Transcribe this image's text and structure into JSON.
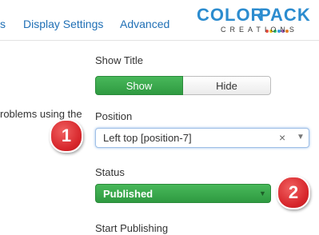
{
  "tabs": {
    "partial_left": "s",
    "display_settings": "Display Settings",
    "advanced": "Advanced"
  },
  "logo": {
    "word_color": "COLOR",
    "word_pack": "PACK",
    "subtitle": "CREATIONS",
    "colors": {
      "blue": "#2c8ccf",
      "dots": [
        "#e84c3d",
        "#f1c40f",
        "#2ecc71",
        "#3498db",
        "#9b59b6",
        "#e67e22"
      ]
    }
  },
  "side_text": "roblems using the",
  "fields": {
    "show_title": {
      "label": "Show Title",
      "options": [
        "Show",
        "Hide"
      ],
      "selected": "Show"
    },
    "position": {
      "label": "Position",
      "value": "Left top [position-7]",
      "clear_icon": "×",
      "caret_icon": "▼"
    },
    "status": {
      "label": "Status",
      "value": "Published",
      "caret_icon": "▼"
    },
    "start_publishing": {
      "label": "Start Publishing"
    }
  },
  "callouts": [
    "1",
    "2"
  ],
  "colors": {
    "accent_green": "#3aa94c",
    "link_blue": "#1f6fb5",
    "badge_red": "#d7262b"
  }
}
